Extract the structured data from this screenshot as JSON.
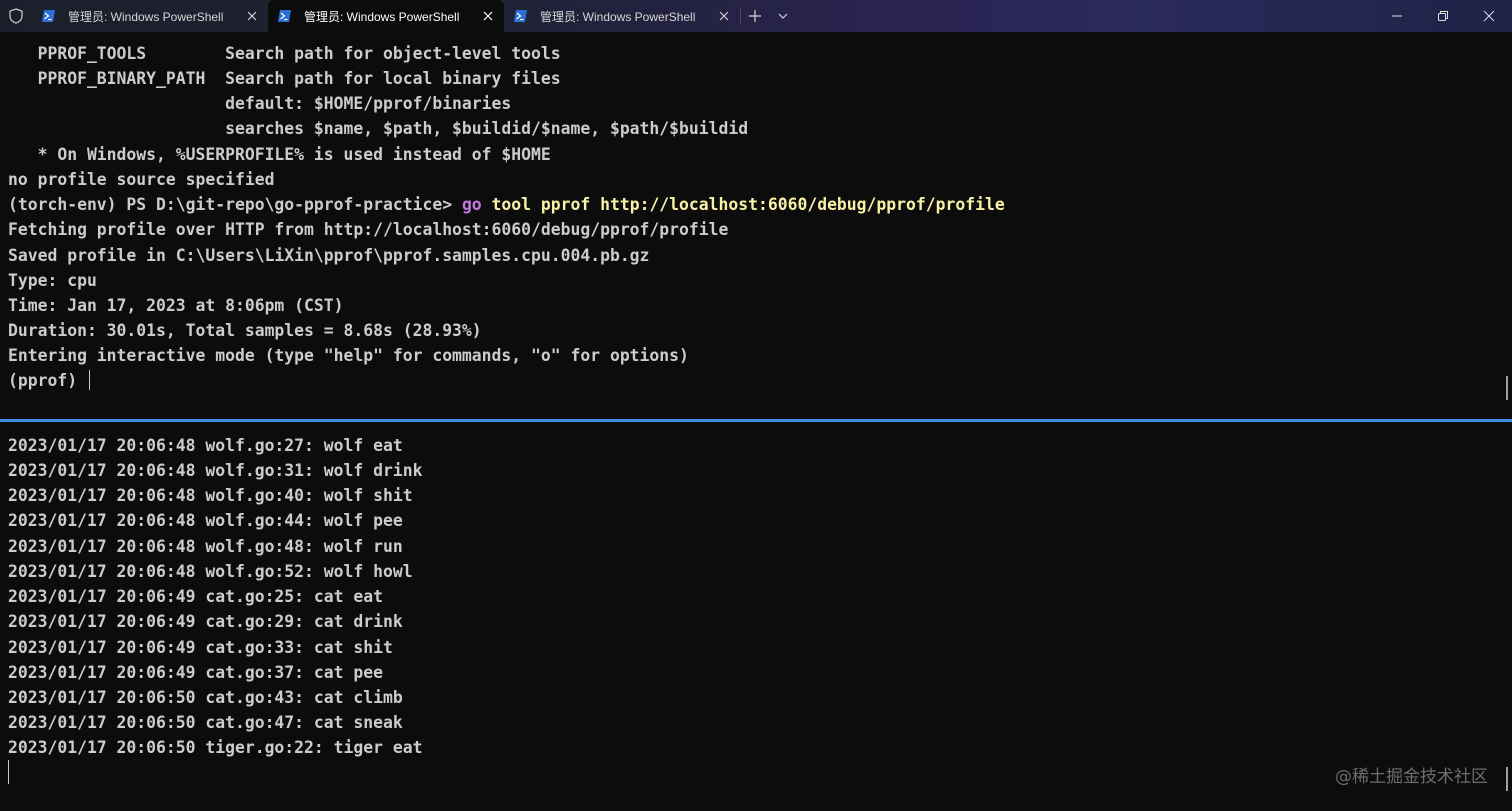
{
  "tabs": [
    {
      "title": "管理员: Windows PowerShell",
      "icon": "powershell-icon",
      "active": false
    },
    {
      "title": "管理员: Windows PowerShell",
      "icon": "powershell-icon",
      "active": true
    },
    {
      "title": "管理员: Windows PowerShell",
      "icon": "powershell-icon",
      "active": false
    }
  ],
  "top_pane": {
    "lines": [
      "   PPROF_TOOLS        Search path for object-level tools",
      "   PPROF_BINARY_PATH  Search path for local binary files",
      "                      default: $HOME/pprof/binaries",
      "                      searches $name, $path, $buildid/$name, $path/$buildid",
      "   * On Windows, %USERPROFILE% is used instead of $HOME",
      "no profile source specified"
    ],
    "prompt": "(torch-env) PS D:\\git-repo\\go-pprof-practice> ",
    "command_go": "go",
    "command_rest": " tool pprof http://localhost:6060/debug/pprof/profile",
    "output": [
      "Fetching profile over HTTP from http://localhost:6060/debug/pprof/profile",
      "Saved profile in C:\\Users\\LiXin\\pprof\\pprof.samples.cpu.004.pb.gz",
      "Type: cpu",
      "Time: Jan 17, 2023 at 8:06pm (CST)",
      "Duration: 30.01s, Total samples = 8.68s (28.93%)",
      "Entering interactive mode (type \"help\" for commands, \"o\" for options)"
    ],
    "pprof_prompt": "(pprof) "
  },
  "bottom_pane": {
    "lines": [
      "2023/01/17 20:06:48 wolf.go:27: wolf eat",
      "2023/01/17 20:06:48 wolf.go:31: wolf drink",
      "2023/01/17 20:06:48 wolf.go:40: wolf shit",
      "2023/01/17 20:06:48 wolf.go:44: wolf pee",
      "2023/01/17 20:06:48 wolf.go:48: wolf run",
      "2023/01/17 20:06:48 wolf.go:52: wolf howl",
      "2023/01/17 20:06:49 cat.go:25: cat eat",
      "2023/01/17 20:06:49 cat.go:29: cat drink",
      "2023/01/17 20:06:49 cat.go:33: cat shit",
      "2023/01/17 20:06:49 cat.go:37: cat pee",
      "2023/01/17 20:06:50 cat.go:43: cat climb",
      "2023/01/17 20:06:50 cat.go:47: cat sneak",
      "2023/01/17 20:06:50 tiger.go:22: tiger eat"
    ]
  },
  "watermark": "@稀土掘金技术社区",
  "colors": {
    "background": "#0c0c0c",
    "text": "#cccccc",
    "command_keyword": "#c678dd",
    "command_args": "#f9f1a5",
    "pane_focus_border": "#3a8ee6"
  }
}
